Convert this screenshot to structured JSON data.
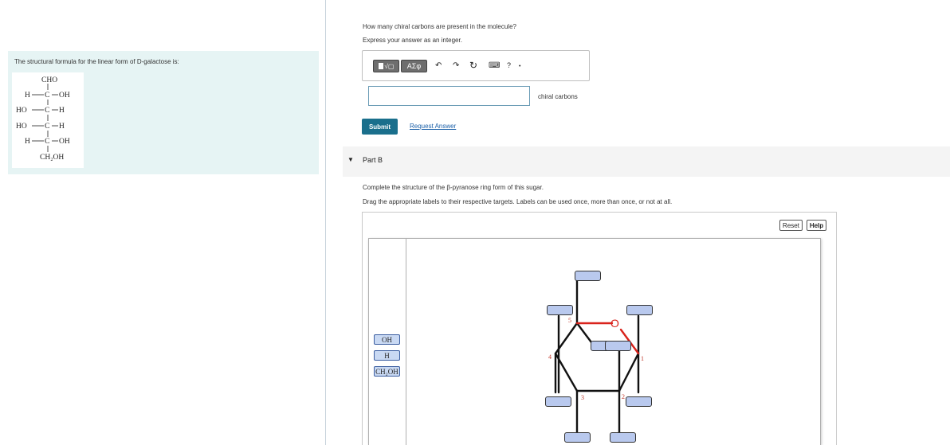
{
  "part_a": {
    "info_text": "The structural formula for the linear form of D-galactose is:",
    "formula_lines": {
      "l1": "CHO",
      "l2_left": "H",
      "l2_c": "C",
      "l2_right": "OH",
      "l3_left": "HO",
      "l3_c": "C",
      "l3_right": "H",
      "l4_left": "HO",
      "l4_c": "C",
      "l4_right": "H",
      "l5_left": "H",
      "l5_c": "C",
      "l5_right": "OH",
      "l6": "CH₂OH"
    },
    "question": "How many chiral carbons are present in the molecule?",
    "instruction": "Express your answer as an integer.",
    "toolbar": {
      "template_btn": "√▢",
      "symbols_btn": "ΑΣφ",
      "undo_icon": "↶",
      "redo_icon": "↷",
      "reset_icon": "↻",
      "keyboard_icon": "⌨",
      "help_icon": "?"
    },
    "answer_value": "",
    "unit_label": "chiral carbons",
    "submit_label": "Submit",
    "request_answer_label": "Request Answer"
  },
  "part_b": {
    "title": "Part B",
    "question": "Complete the structure of the β-pyranose ring form of this sugar.",
    "instruction": "Drag the appropriate labels to their respective targets. Labels can be used once, more than once, or not at all.",
    "reset_label": "Reset",
    "help_label": "Help",
    "labels": [
      "OH",
      "H",
      "CH₂OH"
    ],
    "ring_oxygen": "O",
    "carbon_numbers": [
      "1",
      "2",
      "3",
      "4",
      "5"
    ]
  }
}
